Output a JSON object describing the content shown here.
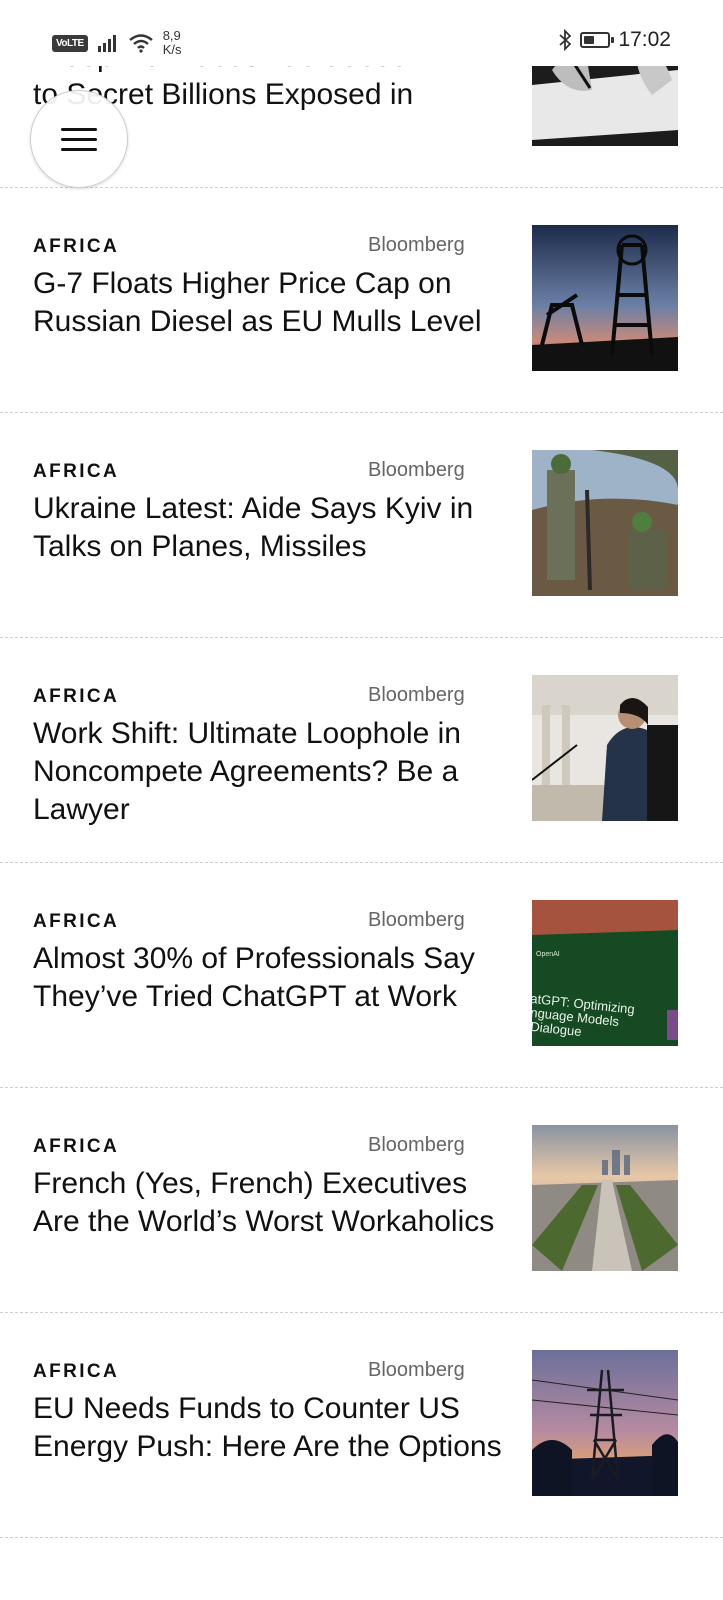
{
  "status_bar": {
    "volte": "VoLTE",
    "speed_value": "8,9",
    "speed_unit": "K/s",
    "time": "17:02",
    "battery_level": 0.45
  },
  "menu": {
    "icon": "hamburger-menu-icon"
  },
  "partial_article": {
    "title_line1": "\"Keep No Traces\" Guidebook",
    "title_line2": "to Secret Billions Exposed in"
  },
  "articles": [
    {
      "category": "AFRICA",
      "source": "Bloomberg",
      "title": "G-7 Floats Higher Price Cap on Russian Diesel as EU Mulls Level",
      "image": "oil-pumps-photo"
    },
    {
      "category": "AFRICA",
      "source": "Bloomberg",
      "title": "Ukraine Latest: Aide Says Kyiv in Talks on Planes, Missiles",
      "image": "soldiers-photo"
    },
    {
      "category": "AFRICA",
      "source": "Bloomberg",
      "title": "Work Shift: Ultimate Loophole in Noncompete Agreements? Be a Lawyer",
      "image": "testimony-photo"
    },
    {
      "category": "AFRICA",
      "source": "Bloomberg",
      "title": "Almost 30% of Professionals Say They’ve Tried ChatGPT at Work",
      "image": "chatgpt-screen-photo",
      "image_text": [
        "OpenAI",
        "atGPT: Optimizing",
        "nguage Models",
        "Dialogue"
      ]
    },
    {
      "category": "AFRICA",
      "source": "Bloomberg",
      "title": "French (Yes, French) Executives Are the World’s Worst Workaholics",
      "image": "paris-skyline-photo"
    },
    {
      "category": "AFRICA",
      "source": "Bloomberg",
      "title": "EU Needs Funds to Counter US Energy Push: Here Are the Options",
      "image": "power-pylon-photo"
    }
  ]
}
